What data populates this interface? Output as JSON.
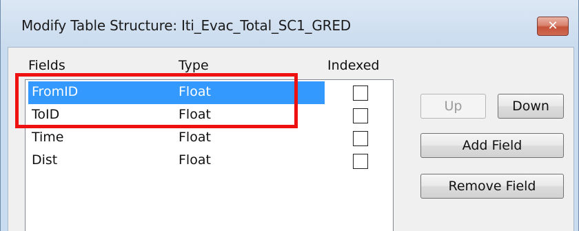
{
  "window": {
    "title": "Modify Table Structure: Iti_Evac_Total_SC1_GRED",
    "close_glyph": "✕"
  },
  "columns": {
    "fields": "Fields",
    "type": "Type",
    "indexed": "Indexed"
  },
  "rows": [
    {
      "name": "FromID",
      "type": "Float",
      "indexed": false,
      "selected": true
    },
    {
      "name": "ToID",
      "type": "Float",
      "indexed": false,
      "selected": false
    },
    {
      "name": "Time",
      "type": "Float",
      "indexed": false,
      "selected": false
    },
    {
      "name": "Dist",
      "type": "Float",
      "indexed": false,
      "selected": false
    }
  ],
  "buttons": {
    "up": "Up",
    "down": "Down",
    "add_field": "Add Field",
    "remove_field": "Remove Field"
  },
  "colors": {
    "selection": "#3399ff",
    "annotation_box": "#ee1111",
    "close_button": "#c6533b"
  }
}
